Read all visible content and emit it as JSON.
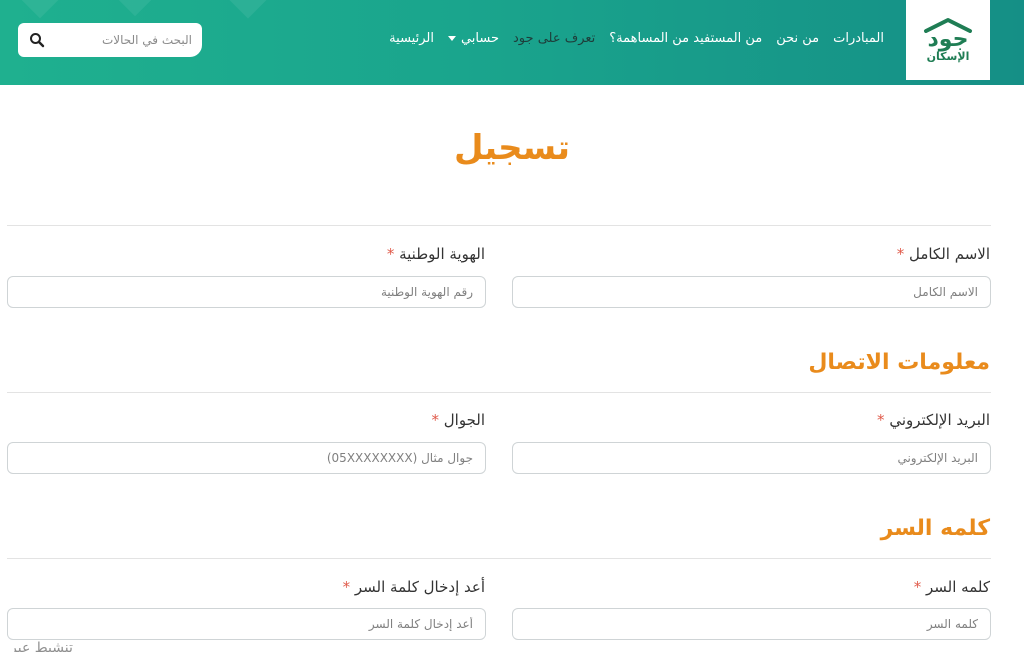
{
  "header": {
    "logo": {
      "main": "جود",
      "sub": "الإسكان"
    },
    "nav": [
      {
        "label": "الرئيسية",
        "dark": false,
        "caret": false
      },
      {
        "label": "حسابي",
        "dark": false,
        "caret": true
      },
      {
        "label": "تعرف على جود",
        "dark": true,
        "caret": false
      },
      {
        "label": "من المستفيد من المساهمة؟",
        "dark": false,
        "caret": false
      },
      {
        "label": "من نحن",
        "dark": false,
        "caret": false
      },
      {
        "label": "المبادرات",
        "dark": false,
        "caret": false
      }
    ],
    "search": {
      "placeholder": "البحث في الحالات",
      "icon": "search-icon"
    }
  },
  "page": {
    "title": "تسجيل",
    "sections": {
      "contact": "معلومات الاتصال",
      "password": "كلمه السر"
    },
    "fields": {
      "full_name": {
        "label": "الاسم الكامل",
        "required": "*",
        "placeholder": "الاسم الكامل"
      },
      "national_id": {
        "label": "الهوية الوطنية",
        "required": "*",
        "placeholder": "رقم الهوية الوطنية"
      },
      "email": {
        "label": "البريد الإلكتروني",
        "required": "*",
        "placeholder": "البريد الإلكتروني"
      },
      "mobile": {
        "label": "الجوال",
        "required": "*",
        "placeholder": "جوال مثال (05XXXXXXXX)"
      },
      "password": {
        "label": "كلمه السر",
        "required": "*",
        "placeholder": "كلمه السر"
      },
      "password_confirm": {
        "label": "أعد إدخال كلمة السر",
        "required": "*",
        "placeholder": "أعد إدخال كلمة السر"
      }
    },
    "cut_text": "تنشيط عبر"
  },
  "colors": {
    "header_start": "#1fb08f",
    "header_end": "#158f86",
    "accent": "#e98b1c",
    "required": "#e05a4a",
    "logo_green": "#1f7d54"
  }
}
